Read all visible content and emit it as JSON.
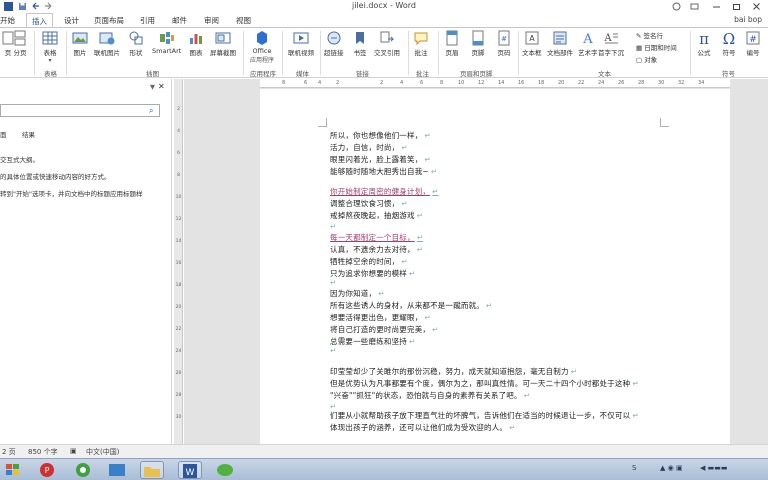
{
  "window": {
    "title": "jilei.docx - Word",
    "user": "bai bop"
  },
  "tabs": [
    "开始",
    "插入",
    "设计",
    "页面布局",
    "引用",
    "邮件",
    "审阅",
    "视图"
  ],
  "active_tab": "插入",
  "ribbon": {
    "buttons": {
      "page": "页",
      "page_break": "分页",
      "table": "表格",
      "picture": "图片",
      "online_picture": "联机图片",
      "shapes": "形状",
      "smartart": "SmartArt",
      "chart": "图表",
      "screenshot": "屏幕截图",
      "office_apps": "Office",
      "office_apps_sub": "应用程序",
      "online_video": "联机视频",
      "hyperlink": "超链接",
      "bookmark": "书签",
      "cross_ref": "交叉引用",
      "comment": "批注",
      "header": "页眉",
      "footer": "页脚",
      "page_number": "页码",
      "textbox": "文本框",
      "quick_parts": "文档部件",
      "wordart": "艺术字",
      "dropcap": "首字下沉",
      "signature_line": "签名行",
      "date_time": "日期和时间",
      "object": "对象",
      "equation": "公式",
      "symbol": "符号",
      "number": "编号"
    },
    "groups": {
      "tables": "表格",
      "illustrations": "插图",
      "apps": "应用程序",
      "media": "媒体",
      "links": "链接",
      "comments": "批注",
      "header_footer": "页眉和页脚",
      "text": "文本",
      "symbols": "符号"
    }
  },
  "nav_pane": {
    "close": "✕",
    "dropdown": "▼",
    "tab_pages": "面",
    "tab_results": "结果",
    "line1": "交互式大纲。",
    "line2": "的具体位置或快速移动内容的好方式。",
    "line3": "转到\"开始\"选项卡，并向文档中的标题应用标题样"
  },
  "document": {
    "lines": [
      "所以，你也想像他们一样，",
      "活力，自信，时尚，",
      "眼里闪着光，脸上露着笑，",
      "能够随时随地大胆秀出自我~",
      "你开始制定周密的健身计划，",
      "调整合理饮食习惯，",
      "戒掉熬夜晚起，抽烟游戏",
      "",
      "每一天都制定一个目标，",
      "认真，不遗余力去对待，",
      "牺牲掉空余的时间，",
      "只为追求你想要的模样",
      "",
      "因为你知道，",
      "所有这些诱人的身材，从来都不是一蹴而就。",
      "想要活得更出色，更耀眼，",
      "将自己打造的更时尚更完美，",
      "总需要一些磨练和坚持",
      "",
      "印莹莹却少了关雎尔的那份沉稳，努力，成天就知道抱怨，毫无自制力",
      "但是优势认为凡事都要有个度，偶尔为之，那叫真性情。可一天二十四个小时都处于这种",
      "\"兴奋\"\"抓狂\"的状态，恐怕就与自身的素养有关系了吧。",
      "",
      "们要从小就帮助孩子放下理直气壮的坏脾气，告诉他们在适当的时候退让一步，不仅可以",
      "体现出孩子的涵养，还可以让他们成为受欢迎的人。"
    ]
  },
  "status": {
    "page": "2 页",
    "words": "850 个字",
    "lang": "中文(中国)"
  },
  "taskbar": {
    "active_label": "F",
    "word_label": "W"
  },
  "colors": {
    "accent": "#2b579a",
    "heading_pink": "#a04070"
  }
}
